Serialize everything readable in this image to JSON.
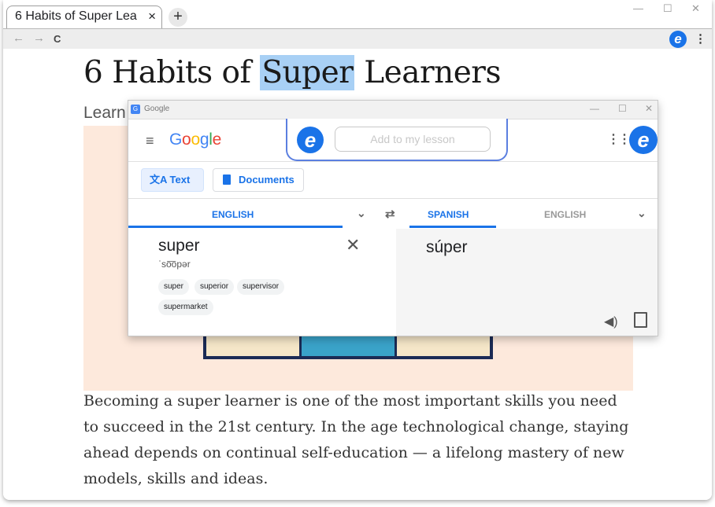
{
  "browser": {
    "tab_title": "6 Habits of Super Lea",
    "tab_close": "×",
    "new_tab": "+",
    "window_minimize": "—",
    "window_maximize": "☐",
    "window_close": "✕",
    "nav_back": "←",
    "nav_forward": "→",
    "nav_reload": "C",
    "extension_letter": "e",
    "menu": "⋮"
  },
  "page": {
    "title_before": "6 Habits of ",
    "title_highlight": "Super",
    "title_after": " Learners",
    "subtitle": "Learn",
    "paragraph": "Becoming a super learner is one of the most important skills you need to succeed in the 21st century. In the age technological change, staying ahead depends on continual self-education — a lifelong mastery of new models, skills and ideas."
  },
  "translate": {
    "window_title": "Google",
    "window_minimize": "—",
    "window_maximize": "☐",
    "window_close": "✕",
    "menu_icon": "≡",
    "logo": [
      "G",
      "o",
      "o",
      "g",
      "l",
      "e"
    ],
    "logo_colors": [
      "#4285f4",
      "#ea4335",
      "#fbbc05",
      "#4285f4",
      "#34a853",
      "#ea4335"
    ],
    "popup_letter": "e",
    "lesson_placeholder": "Add to my lesson",
    "apps_icon": "⋮⋮⋮",
    "account_letter": "e",
    "mode_text": "Text",
    "mode_documents": "Documents",
    "source_lang": "ENGLISH",
    "swap_icon": "⇄",
    "target_lang": "SPANISH",
    "target_lang_alt": "ENGLISH",
    "source_word": "super",
    "phonetic": "ˈso͞opər",
    "clear": "✕",
    "suggestions": [
      "super",
      "superior",
      "supervisor",
      "supermarket"
    ],
    "target_word": "súper",
    "speaker": "🔊",
    "accent": "#1a73e8"
  }
}
